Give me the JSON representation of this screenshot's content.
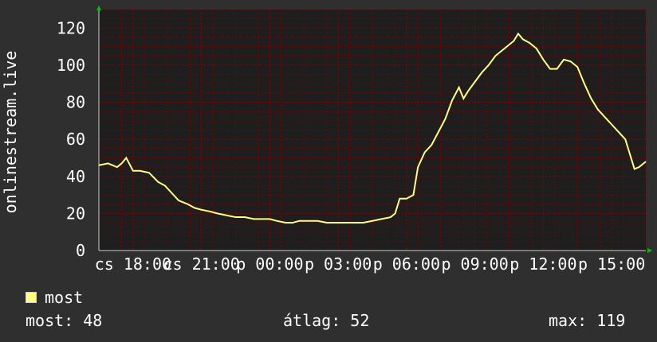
{
  "chart_data": {
    "type": "line",
    "ylabel": "onlinestream.live",
    "ylim": [
      0,
      130
    ],
    "yticks": [
      0,
      20,
      40,
      60,
      80,
      100,
      120
    ],
    "xlim": [
      0,
      24
    ],
    "x_tick_labels": [
      {
        "x": 1.5,
        "label": "cs 18:00"
      },
      {
        "x": 4.5,
        "label": "cs 21:00"
      },
      {
        "x": 7.5,
        "label": "p 00:00"
      },
      {
        "x": 10.5,
        "label": "p 03:00"
      },
      {
        "x": 13.5,
        "label": "p 06:00"
      },
      {
        "x": 16.5,
        "label": "p 09:00"
      },
      {
        "x": 19.5,
        "label": "p 12:00"
      },
      {
        "x": 22.5,
        "label": "p 15:00"
      }
    ],
    "series": [
      {
        "name": "most",
        "color": "#ffff80",
        "x": [
          0.0,
          0.4,
          0.8,
          1.0,
          1.2,
          1.5,
          1.8,
          2.2,
          2.6,
          2.9,
          3.2,
          3.5,
          3.9,
          4.2,
          4.5,
          4.9,
          5.2,
          5.6,
          6.0,
          6.4,
          6.8,
          7.2,
          7.5,
          7.8,
          8.2,
          8.5,
          8.8,
          9.2,
          9.6,
          10.0,
          10.4,
          10.8,
          11.2,
          11.6,
          12.0,
          12.4,
          12.8,
          13.0,
          13.2,
          13.5,
          13.8,
          14.0,
          14.3,
          14.6,
          14.9,
          15.2,
          15.5,
          15.8,
          16.0,
          16.2,
          16.5,
          16.8,
          17.1,
          17.4,
          17.7,
          18.0,
          18.2,
          18.4,
          18.6,
          18.9,
          19.2,
          19.5,
          19.8,
          20.1,
          20.4,
          20.7,
          21.0,
          21.3,
          21.6,
          21.9,
          22.2,
          22.5,
          22.8,
          23.1,
          23.3,
          23.5,
          23.7,
          24.0
        ],
        "y": [
          46,
          47,
          45,
          47,
          50,
          43,
          43,
          42,
          37,
          35,
          31,
          27,
          25,
          23,
          22,
          21,
          20,
          19,
          18,
          18,
          17,
          17,
          17,
          16,
          15,
          15,
          16,
          16,
          16,
          15,
          15,
          15,
          15,
          15,
          16,
          17,
          18,
          20,
          28,
          28,
          30,
          45,
          53,
          57,
          64,
          71,
          81,
          88,
          82,
          86,
          91,
          96,
          100,
          105,
          108,
          111,
          113,
          117,
          114,
          112,
          109,
          103,
          98,
          98,
          103,
          102,
          99,
          90,
          82,
          76,
          72,
          68,
          64,
          60,
          52,
          44,
          45,
          48
        ]
      }
    ]
  },
  "legend": {
    "label": "most",
    "color": "#ffff80"
  },
  "stats": {
    "now": "most: 48",
    "average": "átlag: 52",
    "max": "max: 119"
  },
  "colors": {
    "background": "#2f2f2f",
    "plot_background": "#1e1e1e",
    "grid": "#8b0000",
    "axis_arrow": "#00c000",
    "line": "#ffff80"
  }
}
